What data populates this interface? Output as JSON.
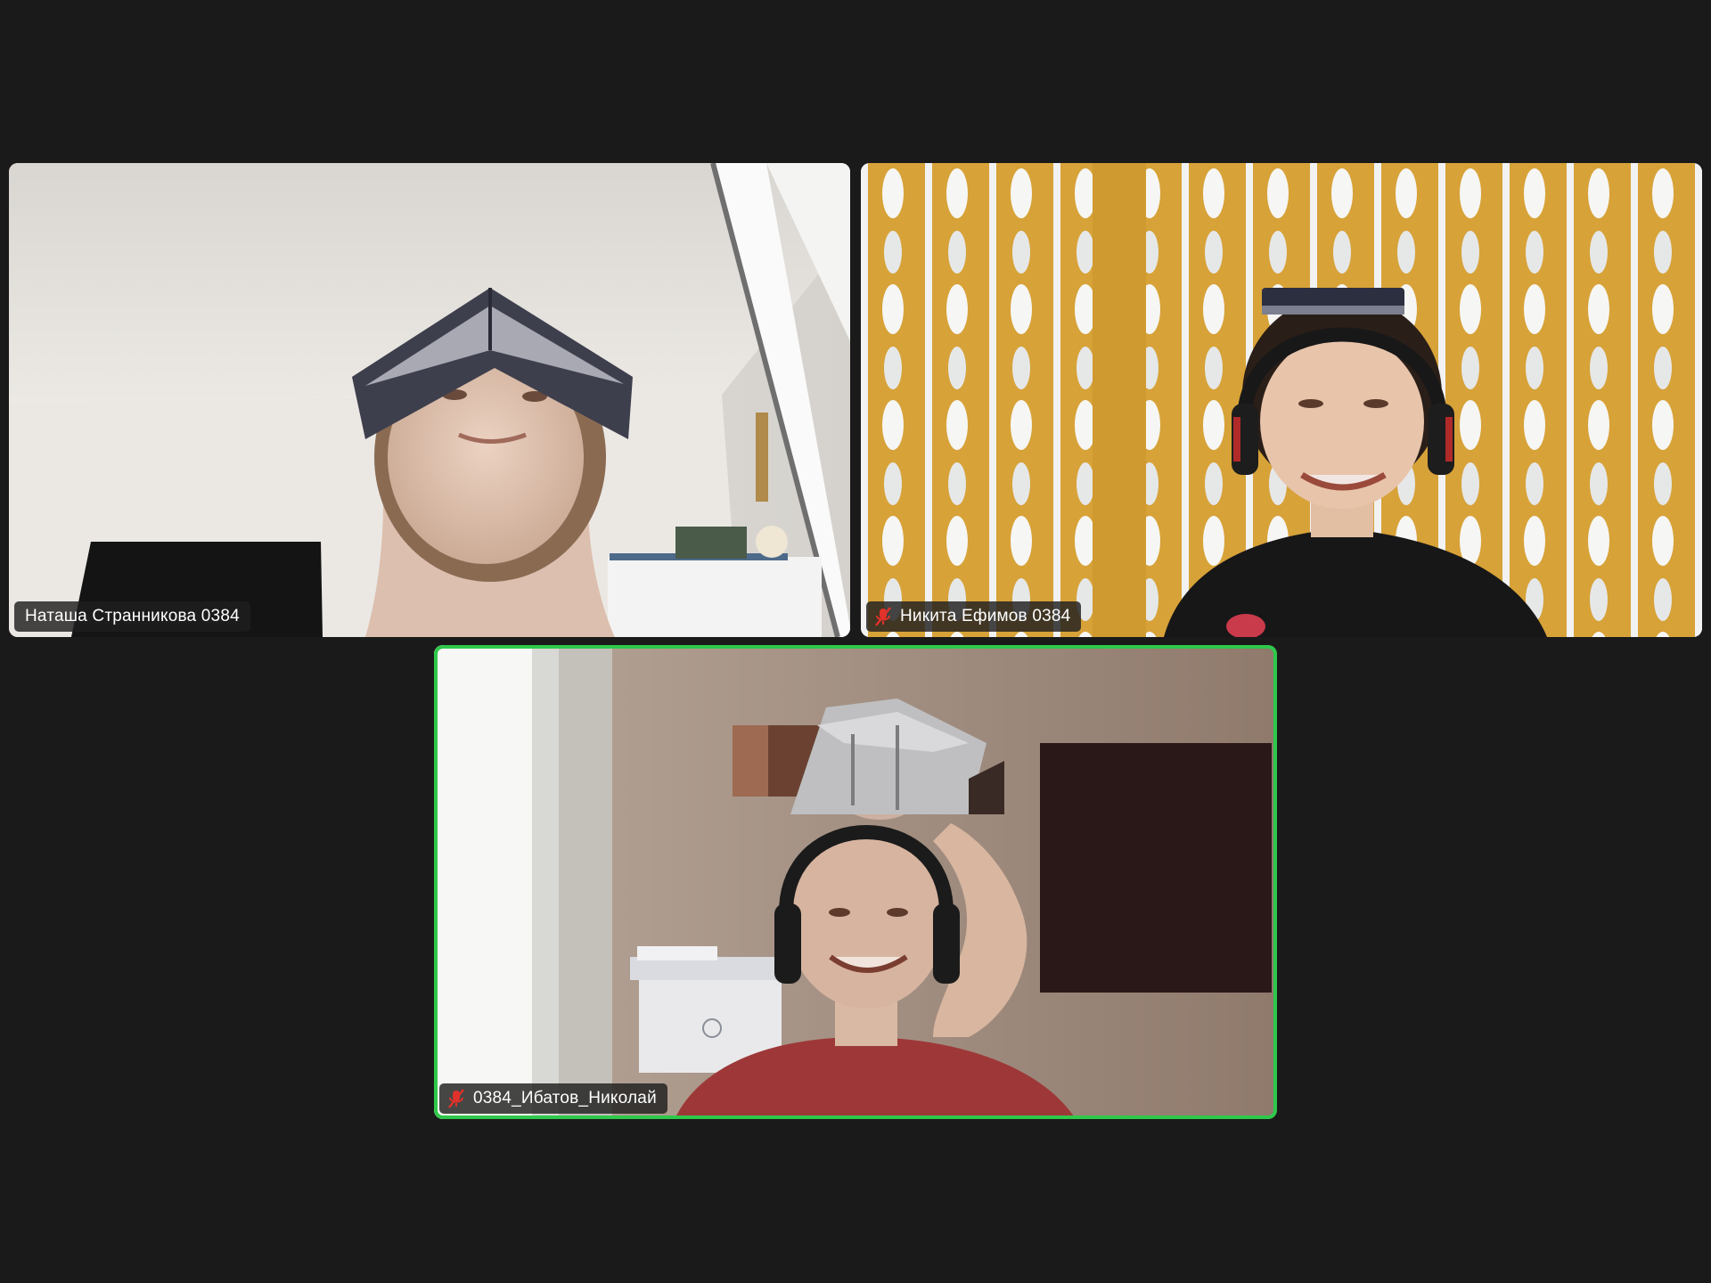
{
  "meeting": {
    "layout": "gallery-view",
    "speaking_color": "#2ec84a",
    "muted_icon_color": "#e0322a",
    "participants": [
      {
        "name": "Наташа Странникова 0384",
        "muted": false,
        "active_speaker": false
      },
      {
        "name": "Никита Ефимов 0384",
        "muted": true,
        "active_speaker": false,
        "icon": "microphone-muted-icon"
      },
      {
        "name": "0384_Ибатов_Николай",
        "muted": true,
        "active_speaker": true,
        "icon": "microphone-muted-icon"
      }
    ]
  }
}
